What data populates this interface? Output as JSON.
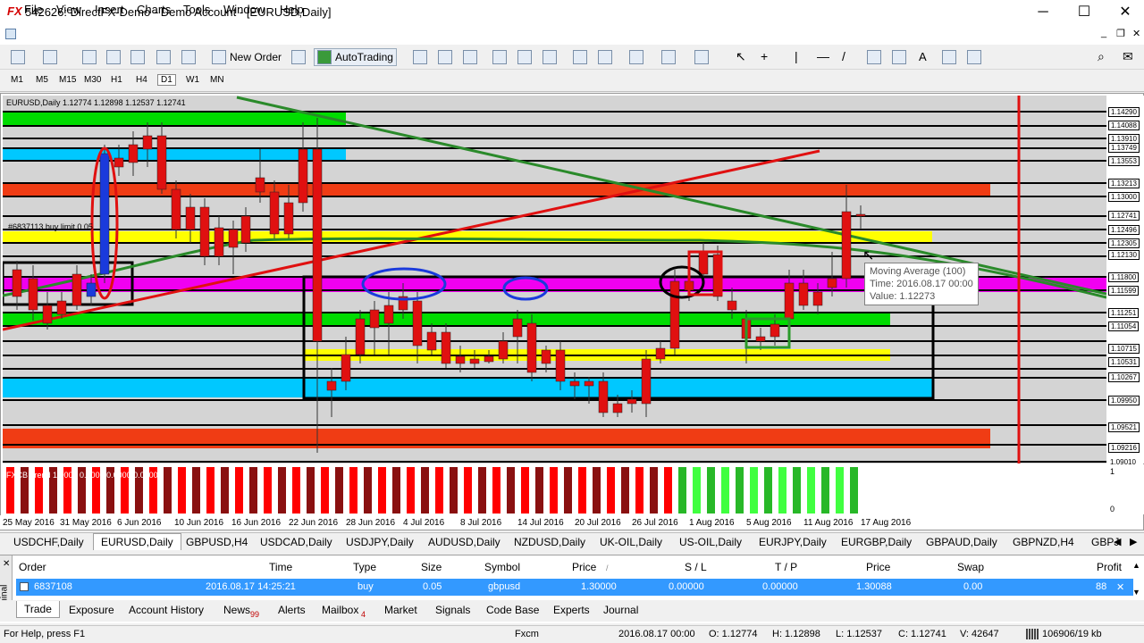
{
  "titlebar": {
    "title": "542626: DirectFX-Demo - Demo Account - [EURUSD,Daily]",
    "minimize": "─",
    "maximize": "☐",
    "close": "✕"
  },
  "menu": [
    "File",
    "View",
    "Insert",
    "Charts",
    "Tools",
    "Window",
    "Help"
  ],
  "mdi": {
    "minimize": "_",
    "restore": "❐",
    "close": "✕"
  },
  "toolbar": {
    "new_order": "New Order",
    "autotrading": "AutoTrading"
  },
  "timeframes": [
    "M1",
    "M5",
    "M15",
    "M30",
    "H1",
    "H4",
    "D1",
    "W1",
    "MN"
  ],
  "chart": {
    "header": "EURUSD,Daily  1.12774 1.12898 1.12537 1.12741",
    "buy_limit_label": "#6837113 buy limit 0.05",
    "indicator_label": "FXCB Trend 1.0000 0.0000 0.0000 0.0000"
  },
  "price_labels": [
    "1.14290",
    "1.14088",
    "1.13910",
    "1.13749",
    "1.13553",
    "1.13213",
    "1.13000",
    "1.12741",
    "1.12496",
    "1.12305",
    "1.12130",
    "1.11800",
    "1.11599",
    "1.11251",
    "1.11054",
    "1.10715",
    "1.10531",
    "1.10267",
    "1.09950",
    "1.09521",
    "1.09216",
    "1.09010"
  ],
  "ind_scale": [
    "1",
    "0"
  ],
  "dates": [
    "25 May 2016",
    "31 May 2016",
    "6 Jun 2016",
    "10 Jun 2016",
    "16 Jun 2016",
    "22 Jun 2016",
    "28 Jun 2016",
    "4 Jul 2016",
    "8 Jul 2016",
    "14 Jul 2016",
    "20 Jul 2016",
    "26 Jul 2016",
    "1 Aug 2016",
    "5 Aug 2016",
    "11 Aug 2016",
    "17 Aug 2016"
  ],
  "tooltip": {
    "line1": "Moving Average (100)",
    "line2": "Time: 2016.08.17 00:00",
    "line3": "Value: 1.12273"
  },
  "symbol_tabs": [
    "USDCHF,Daily",
    "EURUSD,Daily",
    "GBPUSD,H4",
    "USDCAD,Daily",
    "USDJPY,Daily",
    "AUDUSD,Daily",
    "NZDUSD,Daily",
    "UK-OIL,Daily",
    "US-OIL,Daily",
    "EURJPY,Daily",
    "EURGBP,Daily",
    "GBPAUD,Daily",
    "GBPNZD,H4",
    "GBPJ"
  ],
  "terminal": {
    "headers": {
      "order": "Order",
      "time": "Time",
      "type": "Type",
      "size": "Size",
      "symbol": "Symbol",
      "price": "Price",
      "sl": "S / L",
      "tp": "T / P",
      "price2": "Price",
      "swap": "Swap",
      "profit": "Profit"
    },
    "row": {
      "order": "6837108",
      "time": "2016.08.17 14:25:21",
      "type": "buy",
      "size": "0.05",
      "symbol": "gbpusd",
      "price": "1.30000",
      "sl": "0.00000",
      "tp": "0.00000",
      "price2": "1.30088",
      "swap": "0.00",
      "profit": "88"
    },
    "side_label": "Terminal",
    "tabs": [
      "Trade",
      "Exposure",
      "Account History",
      "News",
      "Alerts",
      "Mailbox",
      "Market",
      "Signals",
      "Code Base",
      "Experts",
      "Journal"
    ],
    "news_count": "99",
    "mailbox_count": "4"
  },
  "status": {
    "help": "For Help, press F1",
    "profile": "Fxcm",
    "time": "2016.08.17 00:00",
    "open": "O: 1.12774",
    "high": "H: 1.12898",
    "low": "L: 1.12537",
    "close": "C: 1.12741",
    "volume": "V: 42647",
    "traffic": "106906/19 kb"
  }
}
